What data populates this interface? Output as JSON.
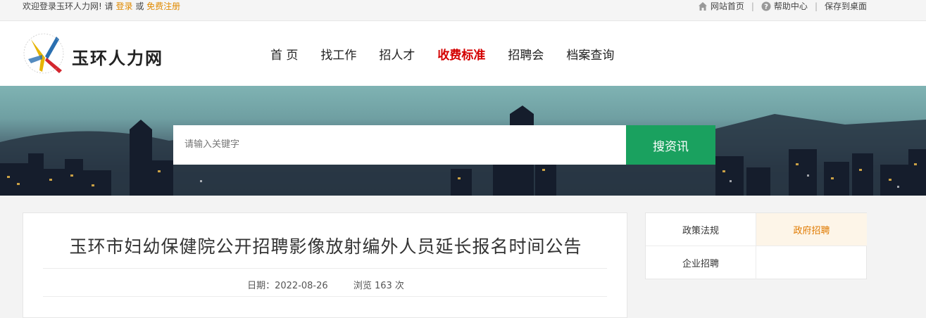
{
  "topbar": {
    "welcome": "欢迎登录玉环人力网! 请",
    "login": "登录",
    "or": "或",
    "register": "免费注册",
    "home": "网站首页",
    "help": "帮助中心",
    "save_desktop": "保存到桌面",
    "sep": "|"
  },
  "header": {
    "site_name": "玉环人力网",
    "nav": [
      "首 页",
      "找工作",
      "招人才",
      "收费标准",
      "招聘会",
      "档案查询"
    ],
    "active_nav": "收费标准"
  },
  "search": {
    "placeholder": "请输入关键字",
    "button": "搜资讯"
  },
  "article": {
    "title": "玉环市妇幼保健院公开招聘影像放射编外人员延长报名时间公告",
    "date": "日期：2022-08-26",
    "views": "浏览 163 次"
  },
  "side_nav": [
    "政策法规",
    "政府招聘",
    "企业招聘"
  ],
  "colors": {
    "accent_orange": "#e08a00",
    "nav_active": "#d40000",
    "search_button": "#1aa15f"
  },
  "icons": {
    "home": "house-icon",
    "help": "question-circle-icon"
  }
}
